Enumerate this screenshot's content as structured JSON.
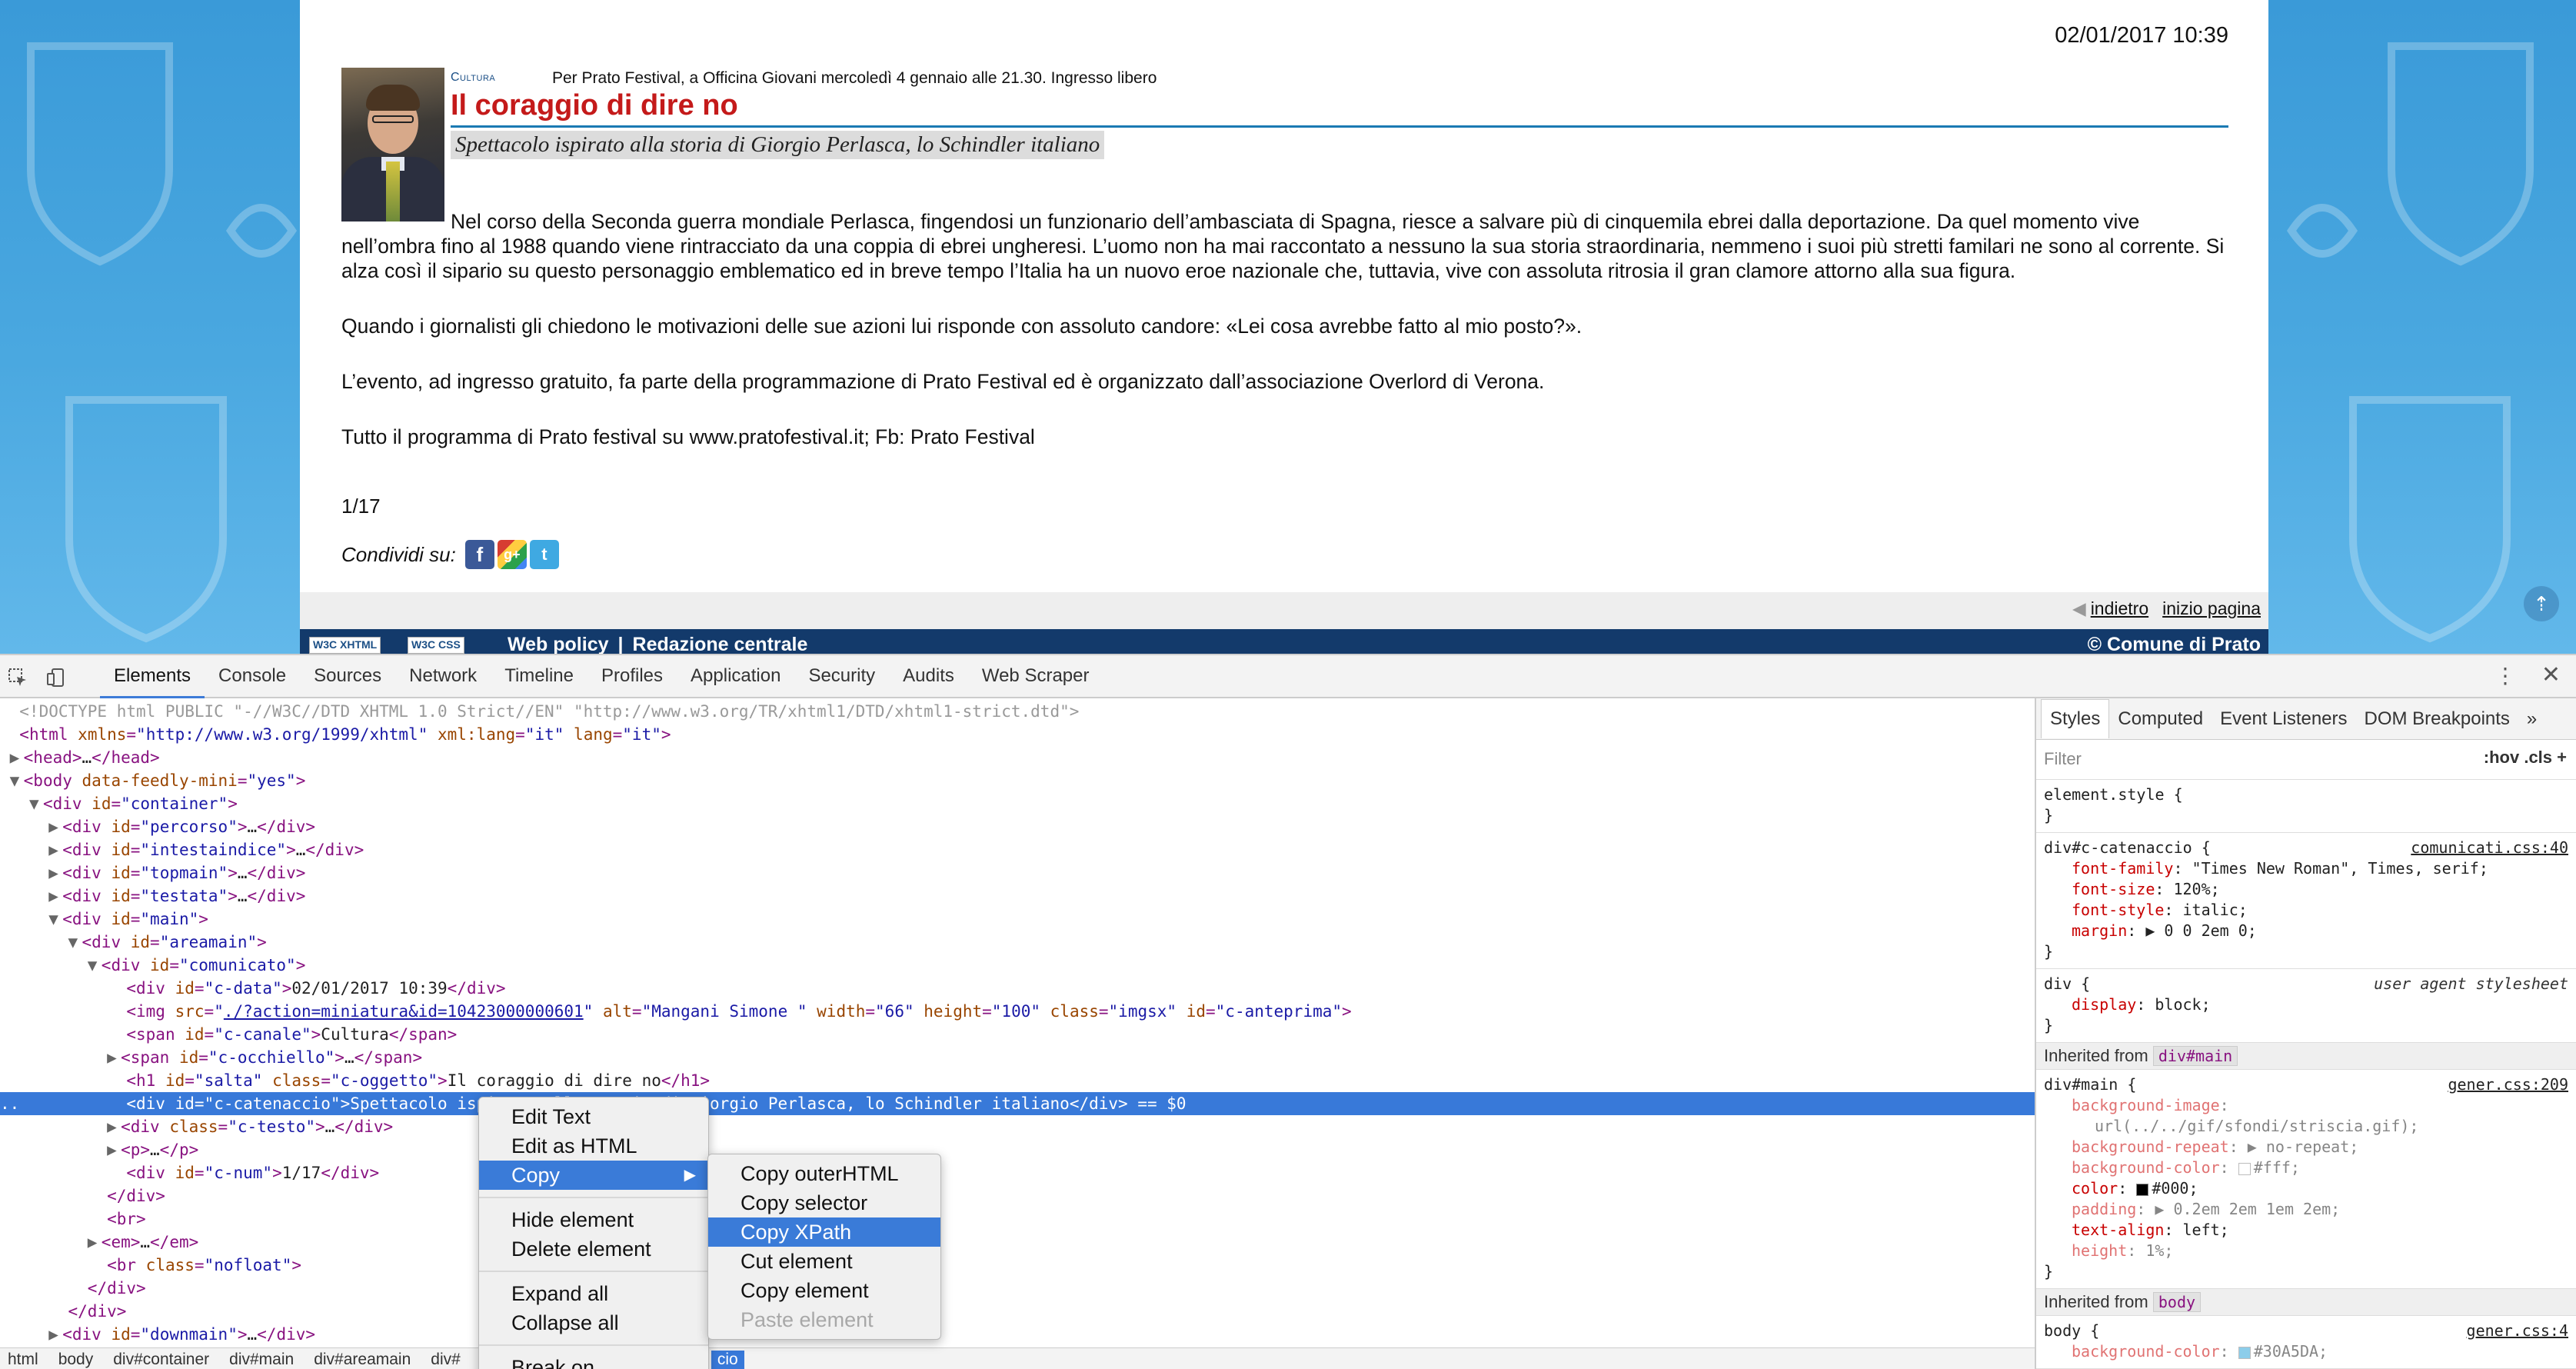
{
  "page": {
    "date": "02/01/2017 10:39",
    "canale": "Cultura",
    "occhiello": "Per Prato Festival, a Officina Giovani mercoledì 4 gennaio alle 21.30. Ingresso libero",
    "title": "Il coraggio di dire no",
    "subtitle": "Spettacolo ispirato alla storia di Giorgio Perlasca, lo Schindler italiano",
    "paragraphs": [
      "Nel corso della Seconda guerra mondiale Perlasca, fingendosi un funzionario dell’ambasciata di Spagna, riesce a salvare più di cinquemila ebrei dalla deportazione. Da quel momento vive nell’ombra fino al 1988 quando viene rintracciato da una coppia di ebrei ungheresi. L’uomo non ha mai raccontato a nessuno la sua storia straordinaria, nemmeno i suoi più stretti familari ne sono al corrente. Si alza così il sipario su questo personaggio emblematico ed in breve tempo l’Italia ha un nuovo eroe nazionale che, tuttavia, vive con assoluta ritrosia il gran clamore attorno alla sua figura.",
      "Quando i giornalisti gli chiedono le motivazioni delle sue azioni lui risponde con assoluto candore: «Lei cosa avrebbe fatto al mio posto?».",
      "L’evento, ad ingresso gratuito,  fa parte della programmazione di Prato Festival ed è organizzato dall’associazione Overlord di Verona.",
      "Tutto il programma di Prato festival su www.pratofestival.it; Fb: Prato Festival"
    ],
    "num": "1/17",
    "share_label": "Condividi su:",
    "share_icons": [
      "facebook-icon",
      "google-plus-icon",
      "twitter-icon"
    ],
    "nav": {
      "back": "indietro",
      "top": "inizio pagina"
    },
    "footer": {
      "badge_xhtml": "W3C XHTML",
      "badge_css": "W3C CSS",
      "web_policy": "Web policy",
      "separator": "|",
      "redazione": "Redazione centrale",
      "copyright": "© Comune di Prato"
    }
  },
  "devtools": {
    "tabs": [
      "Elements",
      "Console",
      "Sources",
      "Network",
      "Timeline",
      "Profiles",
      "Application",
      "Security",
      "Audits",
      "Web Scraper"
    ],
    "active_tab": "Elements",
    "styles_tabs": [
      "Styles",
      "Computed",
      "Event Listeners",
      "DOM Breakpoints",
      "»"
    ],
    "filter_placeholder": "Filter",
    "filter_right": ":hov  .cls  +",
    "breadcrumbs": [
      "html",
      "body",
      "div#container",
      "div#main",
      "div#areamain",
      "div#",
      "cio"
    ],
    "css": {
      "element_style": "element.style {",
      "close": "}",
      "rule1_selector": "div#c-catenaccio {",
      "rule1_src": "comunicati.css:40",
      "rule1_props": [
        {
          "name": "font-family",
          "value": "\"Times New Roman\", Times, serif;"
        },
        {
          "name": "font-size",
          "value": "120%;"
        },
        {
          "name": "font-style",
          "value": "italic;"
        },
        {
          "name": "margin",
          "value": "▶ 0 0 2em 0;"
        }
      ],
      "rule2_selector": "div {",
      "rule2_src": "user agent stylesheet",
      "rule2_props": [
        {
          "name": "display",
          "value": "block;"
        }
      ],
      "inherited1_label": "Inherited from",
      "inherited1_chip": "div#main",
      "rule3_selector": "div#main {",
      "rule3_src": "gener.css:209",
      "rule3_props": [
        {
          "name": "background-image",
          "value": ""
        },
        {
          "name": "",
          "value": "url(../../gif/sfondi/striscia.gif);"
        },
        {
          "name": "background-repeat",
          "value": "▶ no-repeat;"
        },
        {
          "name": "background-color",
          "value": "#fff;"
        },
        {
          "name": "color",
          "value": "#000;"
        },
        {
          "name": "padding",
          "value": "▶ 0.2em 2em 1em 2em;"
        },
        {
          "name": "text-align",
          "value": "left;"
        },
        {
          "name": "height",
          "value": "1%;"
        }
      ],
      "inherited2_chip": "body",
      "rule4_selector": "body {",
      "rule4_src": "gener.css:4",
      "rule4_props": [
        {
          "name": "background-color",
          "value": "#30A5DA;"
        }
      ]
    }
  },
  "context_menu": {
    "items": [
      {
        "label": "Edit Text"
      },
      {
        "label": "Edit as HTML"
      },
      {
        "label": "Copy"
      },
      {
        "label": "Hide element"
      },
      {
        "label": "Delete element"
      },
      {
        "label": "Expand all"
      },
      {
        "label": "Collapse all"
      },
      {
        "label": "Break on..."
      }
    ],
    "submenu": [
      {
        "label": "Copy outerHTML"
      },
      {
        "label": "Copy selector"
      },
      {
        "label": "Copy XPath"
      },
      {
        "label": "Cut element"
      },
      {
        "label": "Copy element"
      },
      {
        "label": "Paste element"
      }
    ]
  },
  "colors": {
    "accent": "#3879d9",
    "title_red": "#c41a1a",
    "footer_blue": "#133a6b",
    "page_bg": "#30A5DA"
  }
}
